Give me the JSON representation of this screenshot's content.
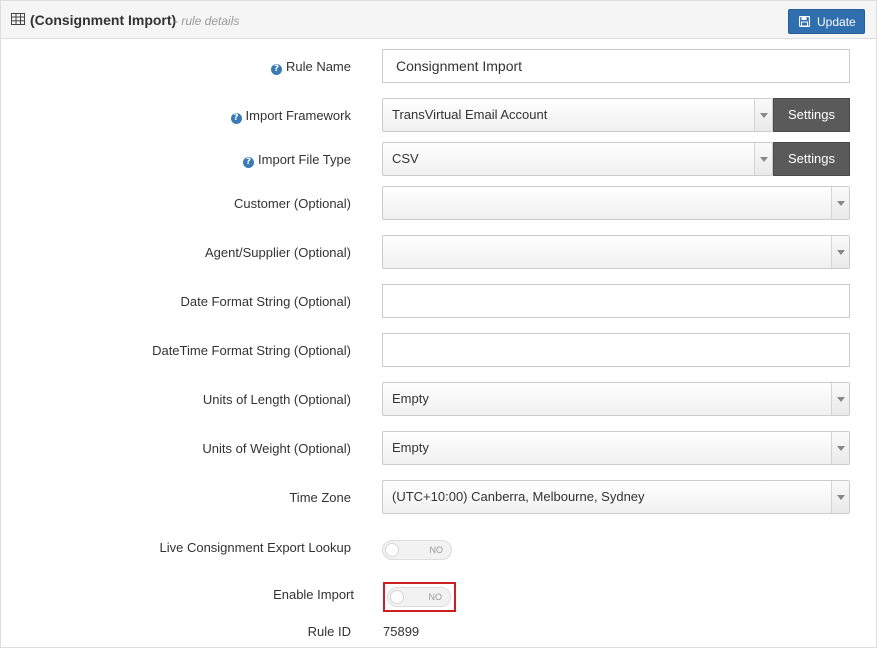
{
  "header": {
    "title": "(Consignment Import)",
    "subtitle": "- rule details",
    "table_icon": "table-icon",
    "update_label": "Update",
    "update_icon": "save-icon",
    "update_color": "#2f6fb0"
  },
  "form": {
    "rule_name": {
      "label": "Rule Name",
      "value": "Consignment Import",
      "help_icon": "question-circle-icon"
    },
    "import_framework": {
      "label": "Import Framework",
      "value": "TransVirtual Email Account",
      "settings_label": "Settings",
      "help_icon": "question-circle-icon"
    },
    "import_file_type": {
      "label": "Import File Type",
      "value": "CSV",
      "settings_label": "Settings",
      "help_icon": "question-circle-icon"
    },
    "customer": {
      "label": "Customer (Optional)",
      "value": ""
    },
    "agent_supplier": {
      "label": "Agent/Supplier (Optional)",
      "value": ""
    },
    "date_format": {
      "label": "Date Format String (Optional)",
      "value": ""
    },
    "datetime_format": {
      "label": "DateTime Format String (Optional)",
      "value": ""
    },
    "units_length": {
      "label": "Units of Length (Optional)",
      "value": "Empty"
    },
    "units_weight": {
      "label": "Units of Weight (Optional)",
      "value": "Empty"
    },
    "time_zone": {
      "label": "Time Zone",
      "value": "(UTC+10:00) Canberra, Melbourne, Sydney"
    },
    "live_lookup": {
      "label": "Live Consignment Export Lookup",
      "toggle_text": "NO"
    },
    "enable_import": {
      "label": "Enable Import",
      "toggle_text": "NO",
      "highlight_color": "#cc1f1f"
    },
    "rule_id": {
      "label": "Rule ID",
      "value": "75899"
    }
  }
}
